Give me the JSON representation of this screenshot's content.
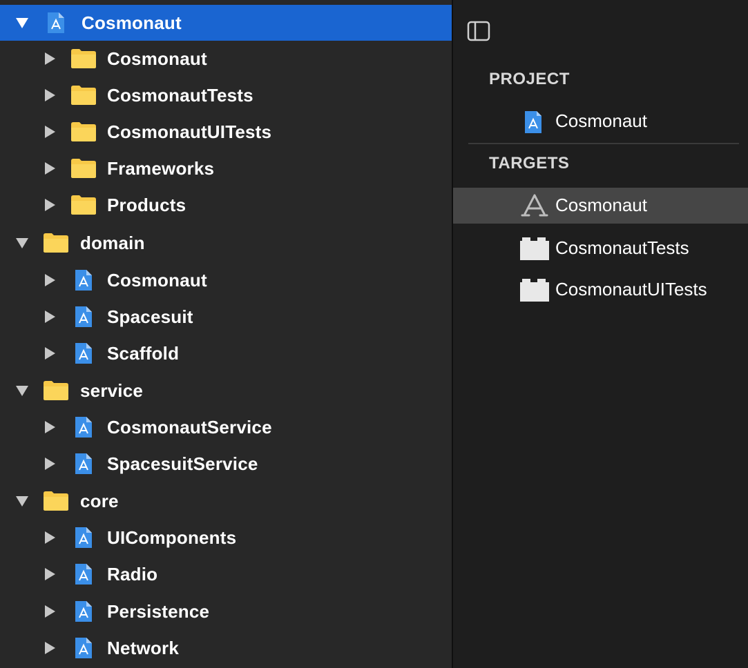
{
  "navigator": {
    "items": [
      {
        "label": "Cosmonaut",
        "kind": "project",
        "expanded": true,
        "level": 0,
        "selected": true
      },
      {
        "label": "Cosmonaut",
        "kind": "folder",
        "expanded": false,
        "level": 1
      },
      {
        "label": "CosmonautTests",
        "kind": "folder",
        "expanded": false,
        "level": 1
      },
      {
        "label": "CosmonautUITests",
        "kind": "folder",
        "expanded": false,
        "level": 1
      },
      {
        "label": "Frameworks",
        "kind": "folder",
        "expanded": false,
        "level": 1
      },
      {
        "label": "Products",
        "kind": "folder",
        "expanded": false,
        "level": 1
      },
      {
        "label": "domain",
        "kind": "folder",
        "expanded": true,
        "level": 0
      },
      {
        "label": "Cosmonaut",
        "kind": "project",
        "expanded": false,
        "level": 1
      },
      {
        "label": "Spacesuit",
        "kind": "project",
        "expanded": false,
        "level": 1
      },
      {
        "label": "Scaffold",
        "kind": "project",
        "expanded": false,
        "level": 1
      },
      {
        "label": "service",
        "kind": "folder",
        "expanded": true,
        "level": 0
      },
      {
        "label": "CosmonautService",
        "kind": "project",
        "expanded": false,
        "level": 1
      },
      {
        "label": "SpacesuitService",
        "kind": "project",
        "expanded": false,
        "level": 1
      },
      {
        "label": "core",
        "kind": "folder",
        "expanded": true,
        "level": 0
      },
      {
        "label": "UIComponents",
        "kind": "project",
        "expanded": false,
        "level": 1
      },
      {
        "label": "Radio",
        "kind": "project",
        "expanded": false,
        "level": 1
      },
      {
        "label": "Persistence",
        "kind": "project",
        "expanded": false,
        "level": 1
      },
      {
        "label": "Network",
        "kind": "project",
        "expanded": false,
        "level": 1
      }
    ]
  },
  "editor": {
    "project_header": "PROJECT",
    "project_item": "Cosmonaut",
    "targets_header": "TARGETS",
    "targets": [
      {
        "label": "Cosmonaut",
        "kind": "app",
        "selected": true
      },
      {
        "label": "CosmonautTests",
        "kind": "bundle",
        "selected": false
      },
      {
        "label": "CosmonautUITests",
        "kind": "bundle",
        "selected": false
      }
    ]
  },
  "colors": {
    "selection": "#1a65d1",
    "navigator_bg": "#282828",
    "editor_bg": "#1e1e1e",
    "folder": "#f7c948",
    "project_icon": "#3b8fe8"
  }
}
